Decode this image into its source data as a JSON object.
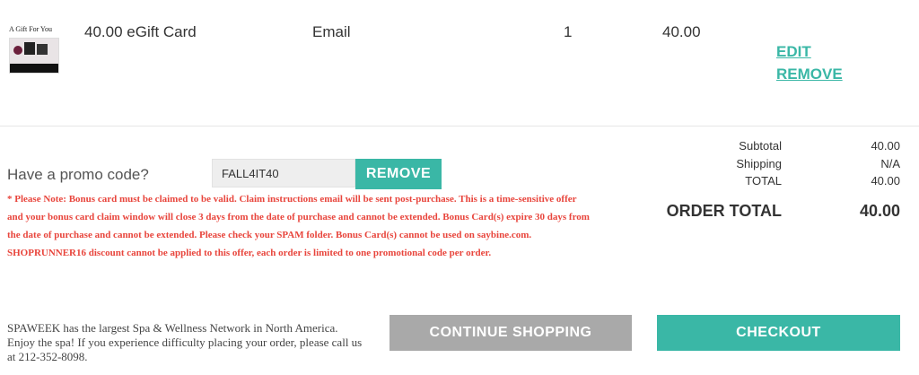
{
  "colors": {
    "accent": "#3ab7a6",
    "secondary_button": "#a9a9a9",
    "warning_text": "#e8453c",
    "text": "#333333"
  },
  "cart_item": {
    "thumbnail_caption": "A Gift For You",
    "thumbnail_icon": "gift-card-image",
    "name": "40.00 eGift Card",
    "delivery": "Email",
    "quantity": "1",
    "price": "40.00",
    "edit_label": "EDIT",
    "remove_label": "REMOVE"
  },
  "promo": {
    "label": "Have a promo code?",
    "code_value": "FALL4IT40",
    "remove_label": "REMOVE",
    "note": "* Please Note: Bonus card must be claimed to be valid. Claim instructions email will be sent post-purchase. This is a time-sensitive offer and your bonus card claim window will close 3 days from the date of purchase and cannot be extended. Bonus Card(s) expire 30 days from the date of purchase and cannot be extended. Please check your SPAM folder. Bonus Card(s) cannot be used on saybine.com. SHOPRUNNER16 discount cannot be applied to this offer, each order is limited to one promotional code per order."
  },
  "totals": {
    "subtotal_label": "Subtotal",
    "subtotal_value": "40.00",
    "shipping_label": "Shipping",
    "shipping_value": "N/A",
    "total_label": "TOTAL",
    "total_value": "40.00",
    "order_total_label": "ORDER TOTAL",
    "order_total_value": "40.00"
  },
  "footer": {
    "info": "SPAWEEK has the largest Spa & Wellness Network in North America. Enjoy the spa! If you experience difficulty placing your order, please call us at 212-352-8098.",
    "continue_label": "CONTINUE SHOPPING",
    "checkout_label": "CHECKOUT"
  }
}
